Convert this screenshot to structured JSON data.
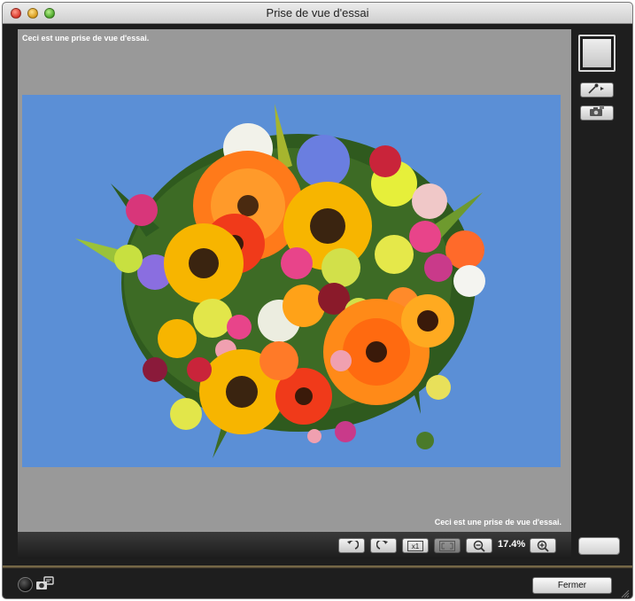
{
  "window": {
    "title": "Prise de vue d'essai"
  },
  "viewer": {
    "caption_top": "Ceci est une prise de vue d'essai.",
    "caption_bottom": "Ceci est une prise de vue d'essai.",
    "photo_subject": "flower bouquet on blue background",
    "background_color": "#999999",
    "photo_background_color": "#5b8fd6"
  },
  "toolbar": {
    "buttons": [
      {
        "name": "rotate-left",
        "icon": "rotate-left-icon"
      },
      {
        "name": "rotate-right",
        "icon": "rotate-right-icon"
      },
      {
        "name": "actual-size",
        "icon": "x1-icon",
        "label": "x1"
      },
      {
        "name": "fit-screen",
        "icon": "fit-screen-icon",
        "disabled": true
      },
      {
        "name": "zoom-out",
        "icon": "zoom-out-icon"
      },
      {
        "name": "zoom-in",
        "icon": "zoom-in-icon"
      }
    ],
    "zoom_level": "17.4%"
  },
  "side_panel": {
    "buttons": [
      {
        "name": "eyedropper",
        "icon": "eyedropper-icon"
      },
      {
        "name": "camera-settings",
        "icon": "camera-settings-icon"
      }
    ]
  },
  "footer": {
    "close_label": "Fermer"
  },
  "colors": {
    "window_bg": "#1e1e1e",
    "accent_line": "#8c7c52"
  }
}
